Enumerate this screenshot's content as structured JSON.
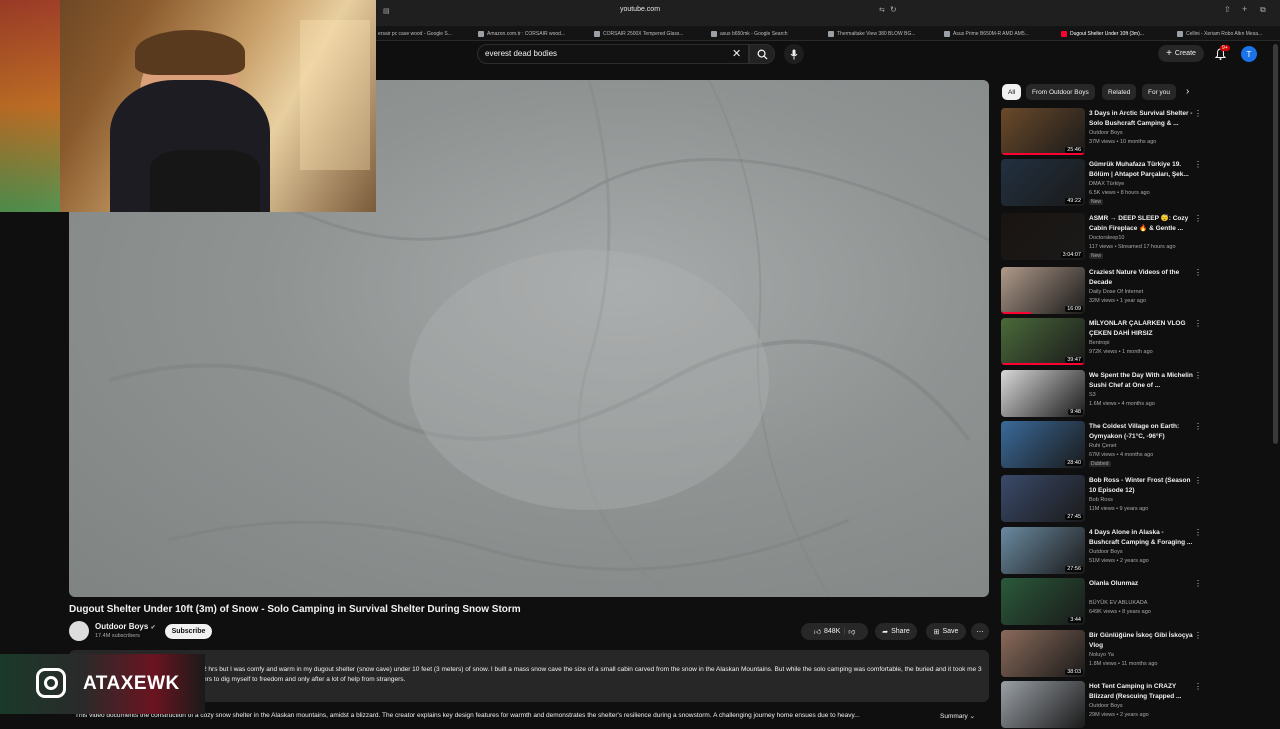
{
  "browser": {
    "url": "youtube.com",
    "tabs": [
      {
        "label": "ersair pc case wood - Google S..."
      },
      {
        "label": "Amazon.com.tr : CORSAIR wood..."
      },
      {
        "label": "CORSAIR 2500X Tempered Glass..."
      },
      {
        "label": "asus b650mk - Google Search"
      },
      {
        "label": "Thermaltake View 380 BLOW BG..."
      },
      {
        "label": "Asus Prime B650M-R AMD AM5..."
      },
      {
        "label": "Dugout Shelter Under 10ft (3m)..."
      },
      {
        "label": "Cellini - Xeriam Robo Altın Mesa..."
      }
    ]
  },
  "header": {
    "search_value": "everest dead bodies",
    "create_label": "Create",
    "notif_badge": "9+",
    "avatar_letter": "T"
  },
  "video": {
    "title": "Dugout Shelter Under 10ft (3m) of Snow - Solo Camping in Survival Shelter During Snow Storm",
    "channel": "Outdoor Boys",
    "subscribers": "17.4M subscribers",
    "subscribe_label": "Subscribe",
    "likes": "848K",
    "share_label": "Share",
    "save_label": "Save",
    "description": "2 hrs but I was comfy and warm in my dugout shelter (snow cave) under 10 feet (3 meters) of snow. I built a mass snow cave the size of a small cabin carved from the snow in the Alaskan Mountains. But while the solo camping was comfortable, the buried and it took me 3 hrs to dig myself to freedom and only after a lot of help from strangers.",
    "summary": "This video documents the construction of a cozy snow shelter in the Alaskan mountains, amidst a blizzard. The creator explains key design features for warmth and demonstrates the shelter's resilience during a snowstorm. A challenging journey home ensues due to heavy...",
    "summary_label": "Summary"
  },
  "overlay": {
    "instagram_name": "ATAXEWK"
  },
  "chips": [
    {
      "label": "All",
      "active": true
    },
    {
      "label": "From Outdoor Boys"
    },
    {
      "label": "Related"
    },
    {
      "label": "For you"
    }
  ],
  "recommendations": [
    {
      "title": "3 Days in Arctic Survival Shelter - Solo Bushcraft Camping & ...",
      "channel": "Outdoor Boys",
      "meta": "37M views • 10 months ago",
      "duration": "25:46",
      "tag": "",
      "color": "#6b4a2a"
    },
    {
      "title": "Gümrük Muhafaza Türkiye 19. Bölüm | Ahtapot Parçaları, Şek...",
      "channel": "DMAX Türkiye",
      "meta": "6.5K views • 8 hours ago",
      "duration": "49:22",
      "tag": "New",
      "color": "#223040"
    },
    {
      "title": "ASMR → DEEP SLEEP 😴: Cozy Cabin Fireplace 🔥 & Gentle ...",
      "channel": "Doctorsleep10",
      "meta": "117 views • Streamed 17 hours ago",
      "duration": "3:04:07",
      "tag": "New",
      "color": "#1a1410"
    },
    {
      "title": "Craziest Nature Videos of the Decade",
      "channel": "Daily Dose Of Internet",
      "meta": "32M views • 1 year ago",
      "duration": "16:09",
      "tag": "",
      "color": "#b09a8a"
    },
    {
      "title": "MİLYONLAR ÇALARKEN VLOG ÇEKEN DAHİ HIRSIZ",
      "channel": "Bentropi",
      "meta": "972K views • 1 month ago",
      "duration": "39:47",
      "tag": "",
      "color": "#4a6a3a"
    },
    {
      "title": "We Spent the Day With a Michelin Sushi Chef at One of ...",
      "channel": "S3",
      "meta": "1.6M views • 4 months ago",
      "duration": "9:48",
      "tag": "",
      "color": "#d8d8d8"
    },
    {
      "title": "The Coldest Village on Earth: Oymyakon (-71°C, -96°F)",
      "channel": "Ruhi Çenet",
      "meta": "67M views • 4 months ago",
      "duration": "28:40",
      "tag": "Dubbed",
      "color": "#3a6a9a"
    },
    {
      "title": "Bob Ross - Winter Frost (Season 10 Episode 12)",
      "channel": "Bob Ross",
      "meta": "11M views • 9 years ago",
      "duration": "27:45",
      "tag": "",
      "color": "#3a4a6a"
    },
    {
      "title": "4 Days Alone in Alaska - Bushcraft Camping & Foraging ...",
      "channel": "Outdoor Boys",
      "meta": "51M views • 2 years ago",
      "duration": "27:56",
      "tag": "",
      "color": "#6a8aa0"
    },
    {
      "title": "Olanla Olunmaz",
      "channel": "BÜYÜK EV ABLUKADA",
      "meta": "649K views • 8 years ago",
      "duration": "3:44",
      "tag": "",
      "color": "#2a5a3a"
    },
    {
      "title": "Bir Günlüğüne İskoç Gibi İskoçya Vlog",
      "channel": "Noluyo Ya",
      "meta": "1.8M views • 11 months ago",
      "duration": "38:03",
      "tag": "",
      "color": "#8a6a5a"
    },
    {
      "title": "Hot Tent Camping in CRAZY Blizzard (Rescuing Trapped ...",
      "channel": "Outdoor Boys",
      "meta": "29M views • 2 years ago",
      "duration": "",
      "tag": "",
      "color": "#9aa0a6"
    }
  ]
}
